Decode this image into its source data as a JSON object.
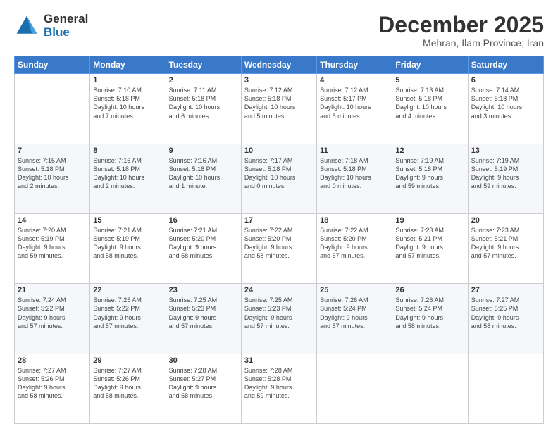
{
  "header": {
    "logo_line1": "General",
    "logo_line2": "Blue",
    "month": "December 2025",
    "location": "Mehran, Ilam Province, Iran"
  },
  "days_of_week": [
    "Sunday",
    "Monday",
    "Tuesday",
    "Wednesday",
    "Thursday",
    "Friday",
    "Saturday"
  ],
  "weeks": [
    [
      {
        "day": "",
        "info": ""
      },
      {
        "day": "1",
        "info": "Sunrise: 7:10 AM\nSunset: 5:18 PM\nDaylight: 10 hours\nand 7 minutes."
      },
      {
        "day": "2",
        "info": "Sunrise: 7:11 AM\nSunset: 5:18 PM\nDaylight: 10 hours\nand 6 minutes."
      },
      {
        "day": "3",
        "info": "Sunrise: 7:12 AM\nSunset: 5:18 PM\nDaylight: 10 hours\nand 5 minutes."
      },
      {
        "day": "4",
        "info": "Sunrise: 7:12 AM\nSunset: 5:17 PM\nDaylight: 10 hours\nand 5 minutes."
      },
      {
        "day": "5",
        "info": "Sunrise: 7:13 AM\nSunset: 5:18 PM\nDaylight: 10 hours\nand 4 minutes."
      },
      {
        "day": "6",
        "info": "Sunrise: 7:14 AM\nSunset: 5:18 PM\nDaylight: 10 hours\nand 3 minutes."
      }
    ],
    [
      {
        "day": "7",
        "info": "Sunrise: 7:15 AM\nSunset: 5:18 PM\nDaylight: 10 hours\nand 2 minutes."
      },
      {
        "day": "8",
        "info": "Sunrise: 7:16 AM\nSunset: 5:18 PM\nDaylight: 10 hours\nand 2 minutes."
      },
      {
        "day": "9",
        "info": "Sunrise: 7:16 AM\nSunset: 5:18 PM\nDaylight: 10 hours\nand 1 minute."
      },
      {
        "day": "10",
        "info": "Sunrise: 7:17 AM\nSunset: 5:18 PM\nDaylight: 10 hours\nand 0 minutes."
      },
      {
        "day": "11",
        "info": "Sunrise: 7:18 AM\nSunset: 5:18 PM\nDaylight: 10 hours\nand 0 minutes."
      },
      {
        "day": "12",
        "info": "Sunrise: 7:19 AM\nSunset: 5:18 PM\nDaylight: 9 hours\nand 59 minutes."
      },
      {
        "day": "13",
        "info": "Sunrise: 7:19 AM\nSunset: 5:19 PM\nDaylight: 9 hours\nand 59 minutes."
      }
    ],
    [
      {
        "day": "14",
        "info": "Sunrise: 7:20 AM\nSunset: 5:19 PM\nDaylight: 9 hours\nand 59 minutes."
      },
      {
        "day": "15",
        "info": "Sunrise: 7:21 AM\nSunset: 5:19 PM\nDaylight: 9 hours\nand 58 minutes."
      },
      {
        "day": "16",
        "info": "Sunrise: 7:21 AM\nSunset: 5:20 PM\nDaylight: 9 hours\nand 58 minutes."
      },
      {
        "day": "17",
        "info": "Sunrise: 7:22 AM\nSunset: 5:20 PM\nDaylight: 9 hours\nand 58 minutes."
      },
      {
        "day": "18",
        "info": "Sunrise: 7:22 AM\nSunset: 5:20 PM\nDaylight: 9 hours\nand 57 minutes."
      },
      {
        "day": "19",
        "info": "Sunrise: 7:23 AM\nSunset: 5:21 PM\nDaylight: 9 hours\nand 57 minutes."
      },
      {
        "day": "20",
        "info": "Sunrise: 7:23 AM\nSunset: 5:21 PM\nDaylight: 9 hours\nand 57 minutes."
      }
    ],
    [
      {
        "day": "21",
        "info": "Sunrise: 7:24 AM\nSunset: 5:22 PM\nDaylight: 9 hours\nand 57 minutes."
      },
      {
        "day": "22",
        "info": "Sunrise: 7:25 AM\nSunset: 5:22 PM\nDaylight: 9 hours\nand 57 minutes."
      },
      {
        "day": "23",
        "info": "Sunrise: 7:25 AM\nSunset: 5:23 PM\nDaylight: 9 hours\nand 57 minutes."
      },
      {
        "day": "24",
        "info": "Sunrise: 7:25 AM\nSunset: 5:23 PM\nDaylight: 9 hours\nand 57 minutes."
      },
      {
        "day": "25",
        "info": "Sunrise: 7:26 AM\nSunset: 5:24 PM\nDaylight: 9 hours\nand 57 minutes."
      },
      {
        "day": "26",
        "info": "Sunrise: 7:26 AM\nSunset: 5:24 PM\nDaylight: 9 hours\nand 58 minutes."
      },
      {
        "day": "27",
        "info": "Sunrise: 7:27 AM\nSunset: 5:25 PM\nDaylight: 9 hours\nand 58 minutes."
      }
    ],
    [
      {
        "day": "28",
        "info": "Sunrise: 7:27 AM\nSunset: 5:26 PM\nDaylight: 9 hours\nand 58 minutes."
      },
      {
        "day": "29",
        "info": "Sunrise: 7:27 AM\nSunset: 5:26 PM\nDaylight: 9 hours\nand 58 minutes."
      },
      {
        "day": "30",
        "info": "Sunrise: 7:28 AM\nSunset: 5:27 PM\nDaylight: 9 hours\nand 58 minutes."
      },
      {
        "day": "31",
        "info": "Sunrise: 7:28 AM\nSunset: 5:28 PM\nDaylight: 9 hours\nand 59 minutes."
      },
      {
        "day": "",
        "info": ""
      },
      {
        "day": "",
        "info": ""
      },
      {
        "day": "",
        "info": ""
      }
    ]
  ]
}
